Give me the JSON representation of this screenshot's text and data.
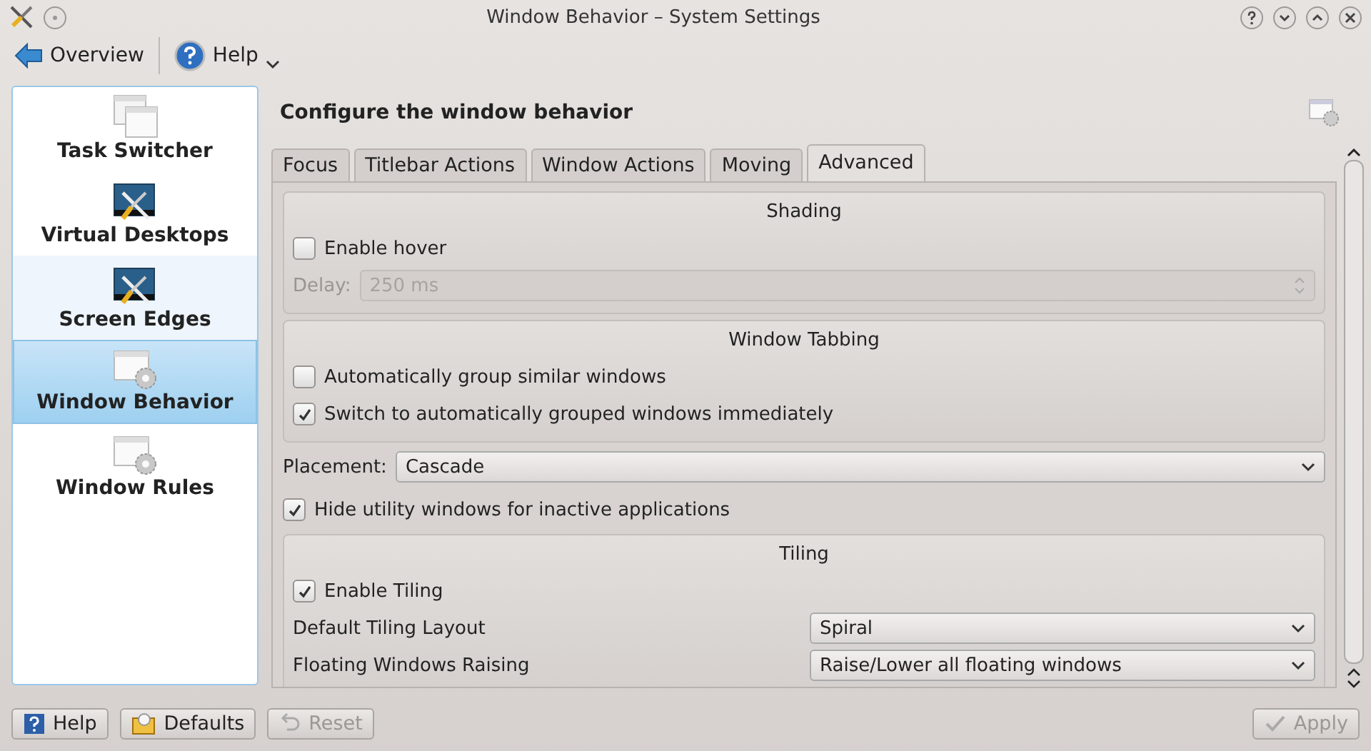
{
  "window": {
    "title": "Window Behavior – System Settings"
  },
  "toolbar": {
    "overview": {
      "label": "Overview"
    },
    "help": {
      "label": "Help",
      "menu": true
    }
  },
  "sidebar": {
    "items": [
      {
        "label": "Task Switcher",
        "kind": "windows",
        "selected": false,
        "hovered": false
      },
      {
        "label": "Virtual Desktops",
        "kind": "tools",
        "selected": false,
        "hovered": false
      },
      {
        "label": "Screen Edges",
        "kind": "tools",
        "selected": false,
        "hovered": true
      },
      {
        "label": "Window Behavior",
        "kind": "window-gear",
        "selected": true,
        "hovered": false
      },
      {
        "label": "Window Rules",
        "kind": "window-gear",
        "selected": false,
        "hovered": false
      }
    ]
  },
  "header": {
    "title": "Configure the window behavior"
  },
  "tabs": [
    {
      "label": "Focus",
      "selected": false
    },
    {
      "label": "Titlebar Actions",
      "selected": false
    },
    {
      "label": "Window Actions",
      "selected": false
    },
    {
      "label": "Moving",
      "selected": false
    },
    {
      "label": "Advanced",
      "selected": true
    }
  ],
  "content": [
    {
      "kind": "group",
      "title": "Shading",
      "rows": [
        {
          "kind": "checkbox",
          "label": "Enable hover",
          "checked": false
        },
        {
          "kind": "spin",
          "label": "Delay:",
          "value": "250 ms",
          "disabled": true
        }
      ]
    },
    {
      "kind": "group",
      "title": "Window Tabbing",
      "rows": [
        {
          "kind": "checkbox",
          "label": "Automatically group similar windows",
          "checked": false
        },
        {
          "kind": "checkbox",
          "label": "Switch to automatically grouped windows immediately",
          "checked": true
        }
      ]
    },
    {
      "kind": "combo",
      "label": "Placement:",
      "value": "Cascade"
    },
    {
      "kind": "checkbox",
      "label": "Hide utility windows for inactive applications",
      "checked": true
    },
    {
      "kind": "group",
      "title": "Tiling",
      "rows": [
        {
          "kind": "checkbox",
          "label": "Enable Tiling",
          "checked": true
        },
        {
          "kind": "combo",
          "label": "Default Tiling Layout",
          "value": "Spiral"
        },
        {
          "kind": "combo",
          "label": "Floating Windows Raising",
          "value": "Raise/Lower all floating windows"
        }
      ]
    }
  ],
  "buttons": {
    "left": [
      {
        "label": "Help",
        "kind": "help",
        "disabled": false
      },
      {
        "label": "Defaults",
        "kind": "defaults",
        "disabled": false
      },
      {
        "label": "Reset",
        "kind": "reset",
        "disabled": true
      }
    ],
    "right": [
      {
        "label": "Apply",
        "kind": "apply",
        "disabled": true
      }
    ]
  }
}
